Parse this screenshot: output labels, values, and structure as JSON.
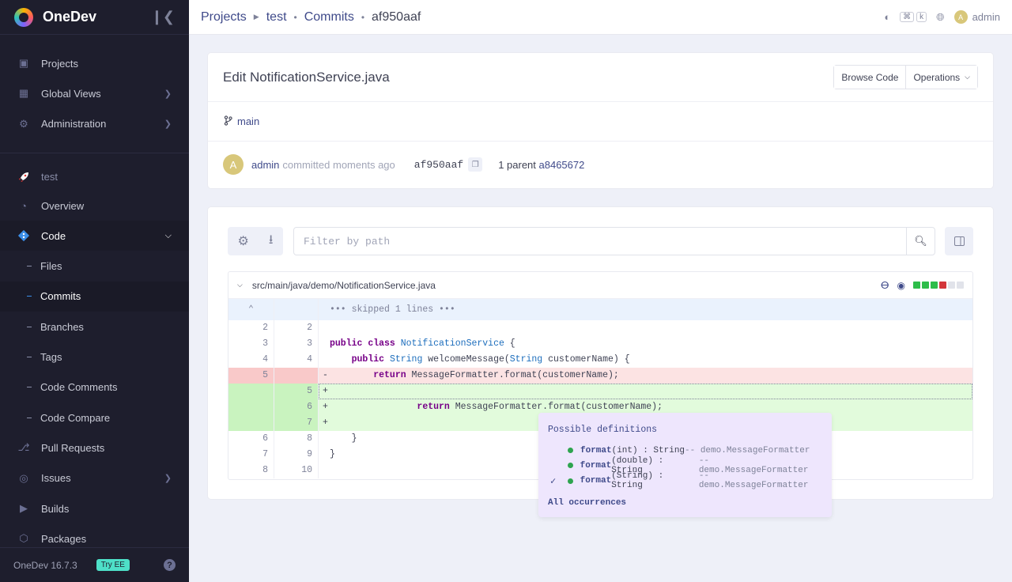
{
  "app": {
    "name": "OneDev",
    "version": "OneDev 16.7.3",
    "try_ee": "Try EE",
    "help": "?"
  },
  "sidebar": {
    "top_items": [
      {
        "label": "Projects"
      },
      {
        "label": "Global Views"
      },
      {
        "label": "Administration"
      }
    ],
    "project_name": "test",
    "project_items": [
      {
        "label": "Overview"
      },
      {
        "label": "Code"
      },
      {
        "label": "Files"
      },
      {
        "label": "Commits"
      },
      {
        "label": "Branches"
      },
      {
        "label": "Tags"
      },
      {
        "label": "Code Comments"
      },
      {
        "label": "Code Compare"
      },
      {
        "label": "Pull Requests"
      },
      {
        "label": "Issues"
      },
      {
        "label": "Builds"
      },
      {
        "label": "Packages"
      }
    ]
  },
  "topbar": {
    "breadcrumb": [
      "Projects",
      "test",
      "Commits",
      "af950aaf"
    ],
    "kbd": [
      "⌘",
      "k"
    ],
    "user": "admin",
    "avatar_letter": "A"
  },
  "commit": {
    "title": "Edit NotificationService.java",
    "browse_code": "Browse Code",
    "operations": "Operations",
    "branch": "main",
    "author": "admin",
    "committed": "committed moments ago",
    "hash": "af950aaf",
    "parent_label": "1 parent",
    "parent_hash": "a8465672"
  },
  "diff": {
    "filter_placeholder": "Filter by path",
    "file_path": "src/main/java/demo/NotificationService.java",
    "skipped": "••• skipped 1 lines •••",
    "stat_colors": [
      "#2ebd4a",
      "#2ebd4a",
      "#2ebd4a",
      "#d3353a",
      "#e1e3ea",
      "#e1e3ea"
    ],
    "lines": [
      {
        "old": "2",
        "new": "2",
        "sign": "",
        "code": ""
      },
      {
        "old": "3",
        "new": "3",
        "sign": "",
        "code": "public class NotificationService {"
      },
      {
        "old": "4",
        "new": "4",
        "sign": "",
        "code": "    public String welcomeMessage(String customerName) {"
      },
      {
        "old": "5",
        "new": "",
        "sign": "-",
        "code": "        return MessageFormatter.format(customerName);"
      },
      {
        "old": "",
        "new": "5",
        "sign": "+",
        "code": ""
      },
      {
        "old": "",
        "new": "6",
        "sign": "+",
        "code": "                return MessageFormatter.format(customerName);"
      },
      {
        "old": "",
        "new": "7",
        "sign": "+",
        "code": ""
      },
      {
        "old": "6",
        "new": "8",
        "sign": "",
        "code": "    }"
      },
      {
        "old": "7",
        "new": "9",
        "sign": "",
        "code": "}"
      },
      {
        "old": "8",
        "new": "10",
        "sign": "",
        "code": ""
      }
    ]
  },
  "popover": {
    "title": "Possible definitions",
    "definitions": [
      {
        "fn": "format",
        "params": "(int)",
        "ret": " : String",
        "pkg": " -- demo.MessageFormatter",
        "selected": false
      },
      {
        "fn": "format",
        "params": "(double)",
        "ret": " : String",
        "pkg": " -- demo.MessageFormatter",
        "selected": false
      },
      {
        "fn": "format",
        "params": "(String)",
        "ret": " : String",
        "pkg": " -- demo.MessageFormatter",
        "selected": true
      }
    ],
    "all_occurrences": "All occurrences"
  }
}
